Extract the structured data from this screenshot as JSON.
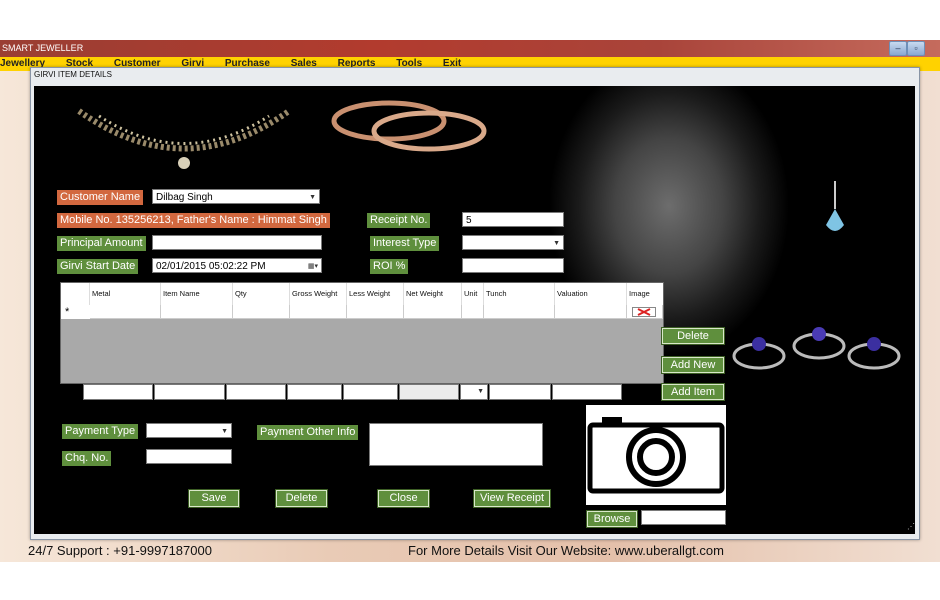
{
  "app": {
    "title": "SMART JEWELLER",
    "menu": [
      "Jewellery",
      "Stock",
      "Customer",
      "Girvi",
      "Purchase",
      "Sales",
      "Reports",
      "Tools",
      "Exit"
    ]
  },
  "window": {
    "title": "GIRVI ITEM DETAILS"
  },
  "form": {
    "customer_name_label": "Customer Name",
    "customer_name_value": "Dilbag Singh",
    "mobile_info": "Mobile No. 135256213, Father's Name : Himmat Singh",
    "receipt_no_label": "Receipt No.",
    "receipt_no_value": "5",
    "principal_amount_label": "Principal Amount",
    "principal_amount_value": "",
    "interest_type_label": "Interest Type",
    "interest_type_value": "",
    "girvi_start_date_label": "Girvi Start Date",
    "girvi_start_date_value": "02/01/2015 05:02:22 PM",
    "roi_label": "ROI %",
    "roi_value": ""
  },
  "grid": {
    "columns": [
      "Metal",
      "Item Name",
      "Qty",
      "Gross Weight",
      "Less Weight",
      "Net Weight",
      "Unit",
      "Tunch",
      "Valuation",
      "Image"
    ],
    "new_row_marker": "*"
  },
  "side_buttons": {
    "delete": "Delete",
    "add_new": "Add New",
    "add_item": "Add Item"
  },
  "payment": {
    "payment_type_label": "Payment Type",
    "payment_type_value": "",
    "payment_other_info_label": "Payment Other Info",
    "payment_other_info_value": "",
    "chq_no_label": "Chq. No.",
    "chq_no_value": ""
  },
  "actions": {
    "save": "Save",
    "delete": "Delete",
    "close": "Close",
    "view_receipt": "View Receipt",
    "browse": "Browse"
  },
  "footer": {
    "support": "24/7 Support : +91-9997187000",
    "website": "For More Details Visit Our Website: www.uberallgt.com"
  },
  "colors": {
    "label_orange": "#d2683f",
    "label_green": "#5f8f3d",
    "menubar_yellow": "#ffd200",
    "titlebar_red": "#b23b2e"
  }
}
